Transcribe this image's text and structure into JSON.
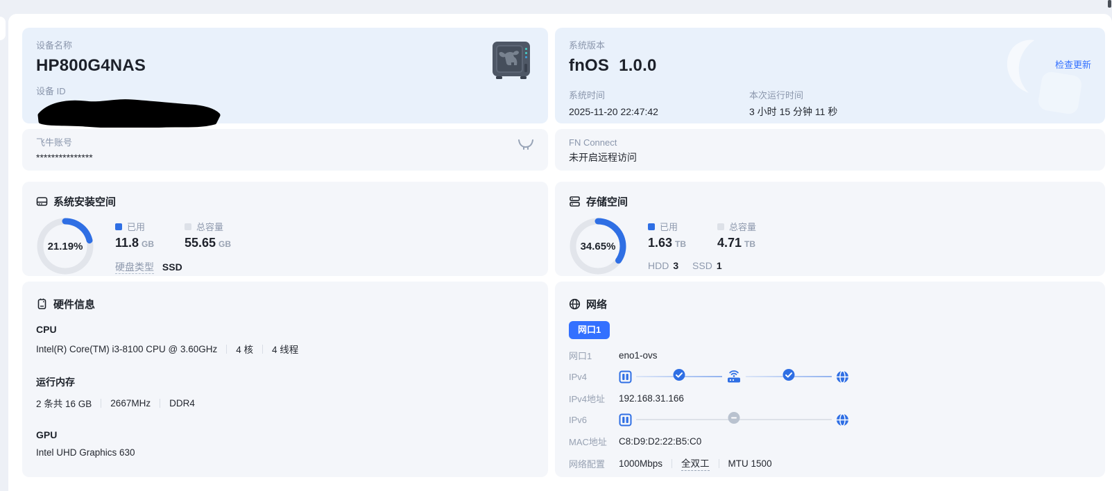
{
  "device": {
    "name_label": "设备名称",
    "name": "HP800G4NAS",
    "id_label": "设备 ID"
  },
  "version": {
    "label": "系统版本",
    "os_name": "fnOS",
    "os_version": "1.0.0",
    "check_update": "检查更新",
    "time_label": "系统时间",
    "time_value": "2025-11-20 22:47:42",
    "uptime_label": "本次运行时间",
    "uptime_value": "3 小时 15 分钟 11 秒"
  },
  "account": {
    "label": "飞牛账号",
    "value": "***************"
  },
  "fn_connect": {
    "label": "FN Connect",
    "value": "未开启远程访问"
  },
  "system_space": {
    "title": "系统安装空间",
    "percent": 21.19,
    "percent_label": "21.19%",
    "used_label": "已用",
    "used_value": "11.8",
    "used_unit": "GB",
    "total_label": "总容量",
    "total_value": "55.65",
    "total_unit": "GB",
    "type_label": "硬盘类型",
    "type_value": "SSD"
  },
  "storage": {
    "title": "存储空间",
    "percent": 34.65,
    "percent_label": "34.65%",
    "used_label": "已用",
    "used_value": "1.63",
    "used_unit": "TB",
    "total_label": "总容量",
    "total_value": "4.71",
    "total_unit": "TB",
    "hdd_label": "HDD",
    "hdd_count": "3",
    "ssd_label": "SSD",
    "ssd_count": "1"
  },
  "hardware": {
    "title": "硬件信息",
    "cpu_label": "CPU",
    "cpu_specs": [
      "Intel(R) Core(TM) i3-8100 CPU @ 3.60GHz",
      "4 核",
      "4 线程"
    ],
    "ram_label": "运行内存",
    "ram_specs": [
      "2 条共 16 GB",
      "2667MHz",
      "DDR4"
    ],
    "gpu_label": "GPU",
    "gpu_value": "Intel UHD Graphics 630"
  },
  "network": {
    "title": "网络",
    "port_tab": "网口1",
    "port_label": "网口1",
    "port_value": "eno1-ovs",
    "ipv4_label": "IPv4",
    "ipv4_addr_label": "IPv4地址",
    "ipv4_addr": "192.168.31.166",
    "ipv6_label": "IPv6",
    "mac_label": "MAC地址",
    "mac_value": "C8:D9:D2:22:B5:C0",
    "config_label": "网络配置",
    "config_speed": "1000Mbps",
    "config_duplex": "全双工",
    "config_mtu": "MTU 1500"
  },
  "colors": {
    "accent": "#3370ff",
    "donut_arc": "#2f6fe4",
    "card_blue": "#e9f1fb",
    "card_gray": "#f4f6fa"
  },
  "icons": {
    "device_image": "nas-tower",
    "account_right": "fn-horns",
    "system_space_header": "disk",
    "storage_header": "server-stack",
    "hardware_header": "chip",
    "network_header": "globe",
    "diagram": [
      "nas",
      "check",
      "router",
      "check",
      "globe"
    ]
  }
}
